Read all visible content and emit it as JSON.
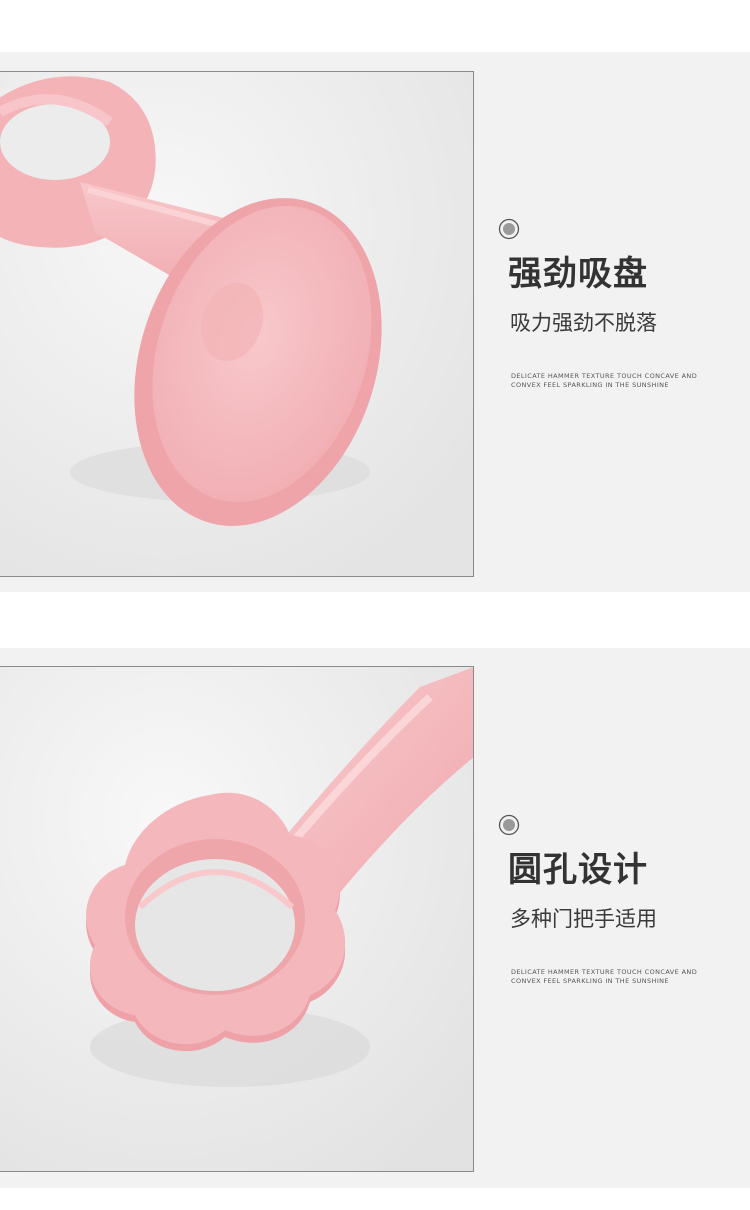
{
  "sections": [
    {
      "icon": "target-ring-icon",
      "title": "强劲吸盘",
      "subtitle": "吸力强劲不脱落",
      "description": "DELICATE HAMMER TEXTURE TOUCH CONCAVE AND CONVEX FEEL SPARKLING IN THE SUNSHINE"
    },
    {
      "icon": "target-ring-icon",
      "title": "圆孔设计",
      "subtitle": "多种门把手适用",
      "description": "DELICATE HAMMER TEXTURE TOUCH CONCAVE AND CONVEX FEEL SPARKLING IN THE SUNSHINE"
    }
  ],
  "colors": {
    "band": "#f2f2f2",
    "product_pink": "#f4b7bb",
    "title_text": "#333333"
  }
}
